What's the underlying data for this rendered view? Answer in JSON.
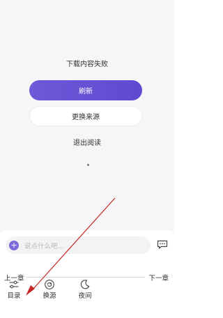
{
  "error": {
    "title": "下载内容失败",
    "refresh_label": "刷新",
    "change_source_label": "更换来源",
    "exit_label": "退出阅读"
  },
  "comment": {
    "placeholder": "说点什么吧..."
  },
  "chapter_nav": {
    "prev_label": "上一章",
    "next_label": "下一章"
  },
  "tabs": [
    {
      "label": "目录",
      "icon": "toc-icon"
    },
    {
      "label": "换源",
      "icon": "switch-source-icon"
    },
    {
      "label": "夜间",
      "icon": "moon-icon"
    }
  ],
  "colors": {
    "accent": "#6c5ad8",
    "annotation_arrow": "#c62828"
  }
}
